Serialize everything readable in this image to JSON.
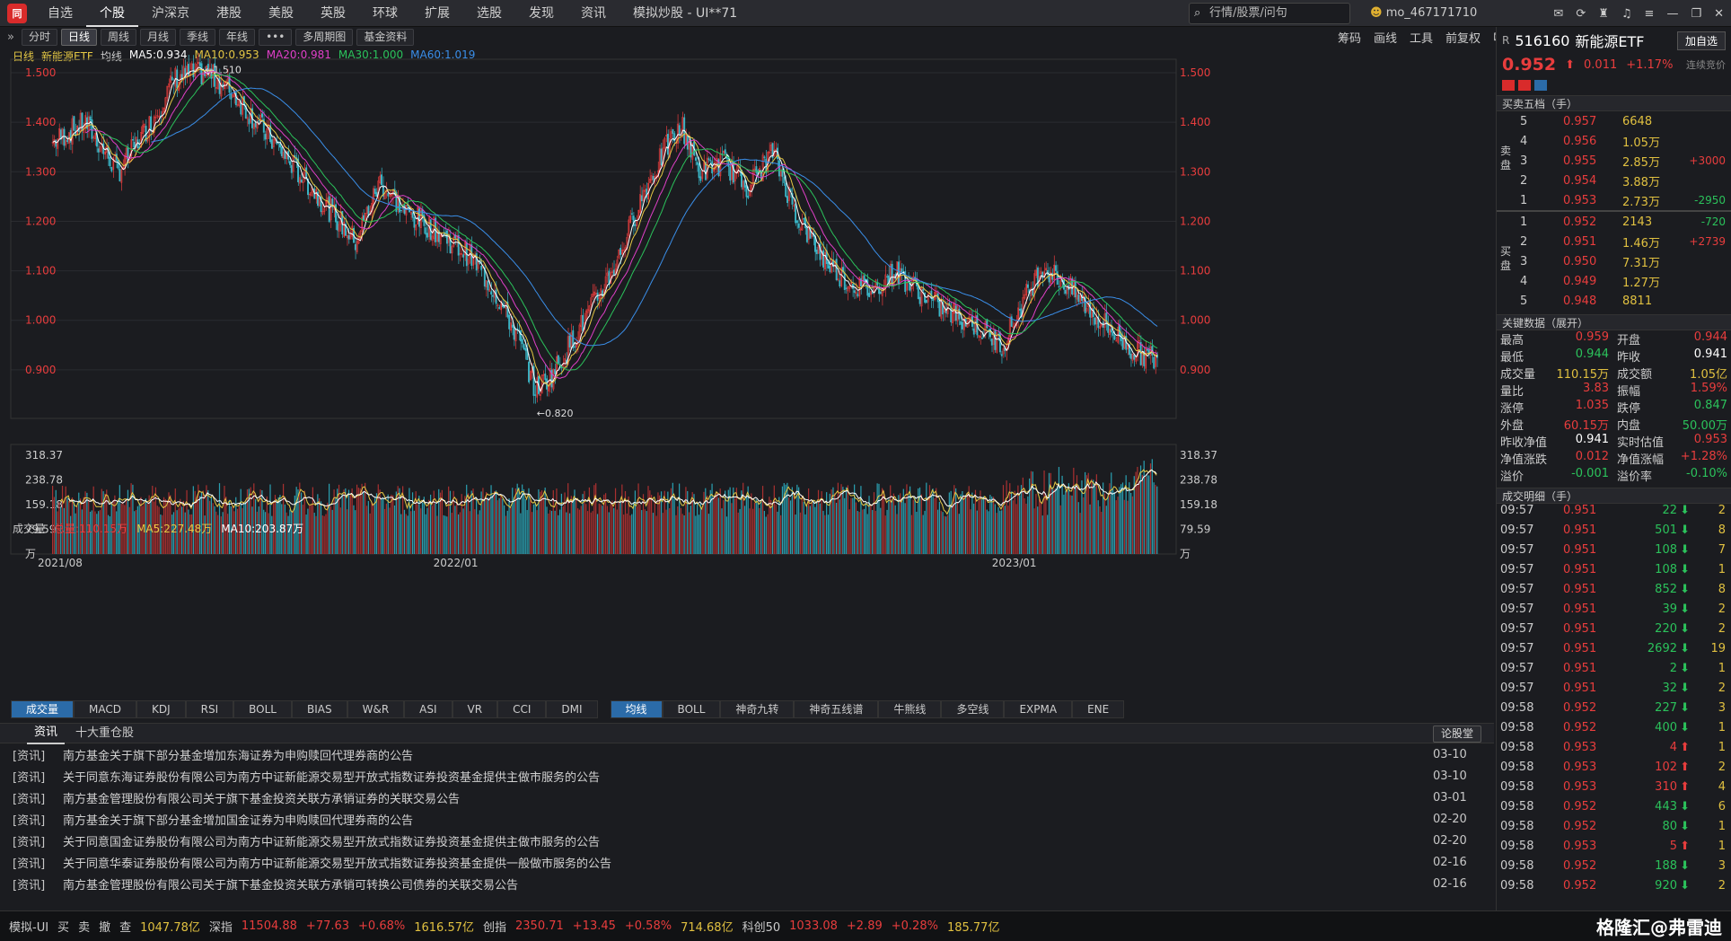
{
  "top": {
    "menu": [
      "自选",
      "个股",
      "沪深京",
      "港股",
      "美股",
      "英股",
      "环球",
      "扩展",
      "选股",
      "发现",
      "资讯",
      "模拟炒股 - UI**71"
    ],
    "active": "个股",
    "search_placeholder": "行情/股票/问句",
    "user": "mo_467171710"
  },
  "toolbar": {
    "periods": [
      "分时",
      "日线",
      "周线",
      "月线",
      "季线",
      "年线",
      "•••",
      "多周期图",
      "基金资料"
    ],
    "active": "日线",
    "right": [
      "筹码",
      "画线",
      "工具",
      "前复权"
    ]
  },
  "ma_legend": {
    "prefix": "日线",
    "name": "新能源ETF",
    "label": "均线",
    "items": [
      {
        "t": "MA5:0.934",
        "c": "#ffffff"
      },
      {
        "t": "MA10:0.953",
        "c": "#e5c845"
      },
      {
        "t": "MA20:0.981",
        "c": "#e040c8"
      },
      {
        "t": "MA30:1.000",
        "c": "#2bc25b"
      },
      {
        "t": "MA60:1.019",
        "c": "#3a8ee8"
      }
    ]
  },
  "price_axis": [
    "1.500",
    "1.400",
    "1.300",
    "1.200",
    "1.100",
    "1.000",
    "0.900"
  ],
  "price_marks": {
    "high": "1.510",
    "low": "0.820"
  },
  "volume": {
    "label": "成交量",
    "total": "总量:110.15万",
    "ma5": "MA5:227.48万",
    "ma10": "MA10:203.87万",
    "axis": [
      "318.37",
      "238.78",
      "159.18",
      "79.59",
      "万"
    ],
    "dates": [
      "2021/08",
      "2022/01",
      "2023/01"
    ]
  },
  "indicator_tabs_left": [
    "成交量",
    "MACD",
    "KDJ",
    "RSI",
    "BOLL",
    "BIAS",
    "W&R",
    "ASI",
    "VR",
    "CCI",
    "DMI"
  ],
  "indicator_tabs_right": [
    "均线",
    "BOLL",
    "神奇九转",
    "神奇五线谱",
    "牛熊线",
    "多空线",
    "EXPMA",
    "ENE"
  ],
  "news": {
    "tabs": [
      "资讯",
      "十大重仓股"
    ],
    "button": "论股堂",
    "tag": "[资讯]",
    "items": [
      {
        "t": "南方基金关于旗下部分基金增加东海证券为申购赎回代理券商的公告",
        "d": "03-10"
      },
      {
        "t": "关于同意东海证券股份有限公司为南方中证新能源交易型开放式指数证券投资基金提供主做市服务的公告",
        "d": "03-10"
      },
      {
        "t": "南方基金管理股份有限公司关于旗下基金投资关联方承销证券的关联交易公告",
        "d": "03-01"
      },
      {
        "t": "南方基金关于旗下部分基金增加国金证券为申购赎回代理券商的公告",
        "d": "02-20"
      },
      {
        "t": "关于同意国金证券股份有限公司为南方中证新能源交易型开放式指数证券投资基金提供主做市服务的公告",
        "d": "02-20"
      },
      {
        "t": "关于同意华泰证券股份有限公司为南方中证新能源交易型开放式指数证券投资基金提供一般做市服务的公告",
        "d": "02-16"
      },
      {
        "t": "南方基金管理股份有限公司关于旗下基金投资关联方承销可转换公司债券的关联交易公告",
        "d": "02-16"
      }
    ]
  },
  "status": {
    "label": "模拟-UI",
    "btns": [
      "买",
      "卖",
      "撤",
      "查"
    ],
    "items": [
      {
        "t": "1047.78亿",
        "c": "#e0c040"
      },
      {
        "t": "深指",
        "c": "#ccc"
      },
      {
        "t": "11504.88",
        "c": "#e83d3d"
      },
      {
        "t": "+77.63",
        "c": "#e83d3d"
      },
      {
        "t": "+0.68%",
        "c": "#e83d3d"
      },
      {
        "t": "1616.57亿",
        "c": "#e0c040"
      },
      {
        "t": "创指",
        "c": "#ccc"
      },
      {
        "t": "2350.71",
        "c": "#e83d3d"
      },
      {
        "t": "+13.45",
        "c": "#e83d3d"
      },
      {
        "t": "+0.58%",
        "c": "#e83d3d"
      },
      {
        "t": "714.68亿",
        "c": "#e0c040"
      },
      {
        "t": "科创50",
        "c": "#ccc"
      },
      {
        "t": "1033.08",
        "c": "#e83d3d"
      },
      {
        "t": "+2.89",
        "c": "#e83d3d"
      },
      {
        "t": "+0.28%",
        "c": "#e83d3d"
      },
      {
        "t": "185.77亿",
        "c": "#e0c040"
      }
    ],
    "watermark": "格隆汇@弗雷迪"
  },
  "quote": {
    "code": "516160",
    "name": "新能源ETF",
    "button": "加自选",
    "price": "0.952",
    "change": "0.011",
    "pct": "+1.17%",
    "note": "连续竞价"
  },
  "orderbook": {
    "title": "买卖五档（手）",
    "sell": [
      {
        "n": "5",
        "p": "0.957",
        "v": "6648",
        "d": ""
      },
      {
        "n": "4",
        "p": "0.956",
        "v": "1.05万",
        "d": ""
      },
      {
        "n": "3",
        "p": "0.955",
        "v": "2.85万",
        "d": "+3000"
      },
      {
        "n": "2",
        "p": "0.954",
        "v": "3.88万",
        "d": ""
      },
      {
        "n": "1",
        "p": "0.953",
        "v": "2.73万",
        "d": "-2950"
      }
    ],
    "buy": [
      {
        "n": "1",
        "p": "0.952",
        "v": "2143",
        "d": "-720"
      },
      {
        "n": "2",
        "p": "0.951",
        "v": "1.46万",
        "d": "+2739"
      },
      {
        "n": "3",
        "p": "0.950",
        "v": "7.31万",
        "d": ""
      },
      {
        "n": "4",
        "p": "0.949",
        "v": "1.27万",
        "d": ""
      },
      {
        "n": "5",
        "p": "0.948",
        "v": "8811",
        "d": ""
      }
    ],
    "sell_label": "卖盘",
    "buy_label": "买盘"
  },
  "keydata": {
    "title": "关键数据（展开）",
    "rows": [
      [
        "最高",
        "0.959",
        "开盘",
        "0.944"
      ],
      [
        "最低",
        "0.944",
        "昨收",
        "0.941"
      ],
      [
        "成交量",
        "110.15万",
        "成交额",
        "1.05亿"
      ],
      [
        "量比",
        "3.83",
        "振幅",
        "1.59%"
      ],
      [
        "涨停",
        "1.035",
        "跌停",
        "0.847"
      ],
      [
        "外盘",
        "60.15万",
        "内盘",
        "50.00万"
      ],
      [
        "昨收净值",
        "0.941",
        "实时估值",
        "0.953"
      ],
      [
        "净值涨跌",
        "0.012",
        "净值涨幅",
        "+1.28%"
      ],
      [
        "溢价",
        "-0.001",
        "溢价率",
        "-0.10%"
      ]
    ]
  },
  "trades": {
    "title": "成交明细（手）",
    "rows": [
      [
        "09:57",
        "0.951",
        "22",
        "2"
      ],
      [
        "09:57",
        "0.951",
        "501",
        "8"
      ],
      [
        "09:57",
        "0.951",
        "108",
        "7"
      ],
      [
        "09:57",
        "0.951",
        "108",
        "1"
      ],
      [
        "09:57",
        "0.951",
        "852",
        "8"
      ],
      [
        "09:57",
        "0.951",
        "39",
        "2"
      ],
      [
        "09:57",
        "0.951",
        "220",
        "2"
      ],
      [
        "09:57",
        "0.951",
        "2692",
        "19"
      ],
      [
        "09:57",
        "0.951",
        "2",
        "1"
      ],
      [
        "09:57",
        "0.951",
        "32",
        "2"
      ],
      [
        "09:58",
        "0.952",
        "227",
        "3"
      ],
      [
        "09:58",
        "0.952",
        "400",
        "1"
      ],
      [
        "09:58",
        "0.953",
        "4",
        "1"
      ],
      [
        "09:58",
        "0.953",
        "102",
        "2"
      ],
      [
        "09:58",
        "0.953",
        "310",
        "4"
      ],
      [
        "09:58",
        "0.952",
        "443",
        "6"
      ],
      [
        "09:58",
        "0.952",
        "80",
        "1"
      ],
      [
        "09:58",
        "0.953",
        "5",
        "1"
      ],
      [
        "09:58",
        "0.952",
        "188",
        "3"
      ],
      [
        "09:58",
        "0.952",
        "920",
        "2"
      ]
    ],
    "dirs": [
      "down",
      "down",
      "down",
      "down",
      "down",
      "down",
      "down",
      "down",
      "down",
      "down",
      "down",
      "down",
      "up",
      "up",
      "up",
      "down",
      "down",
      "up",
      "down",
      "down"
    ]
  }
}
